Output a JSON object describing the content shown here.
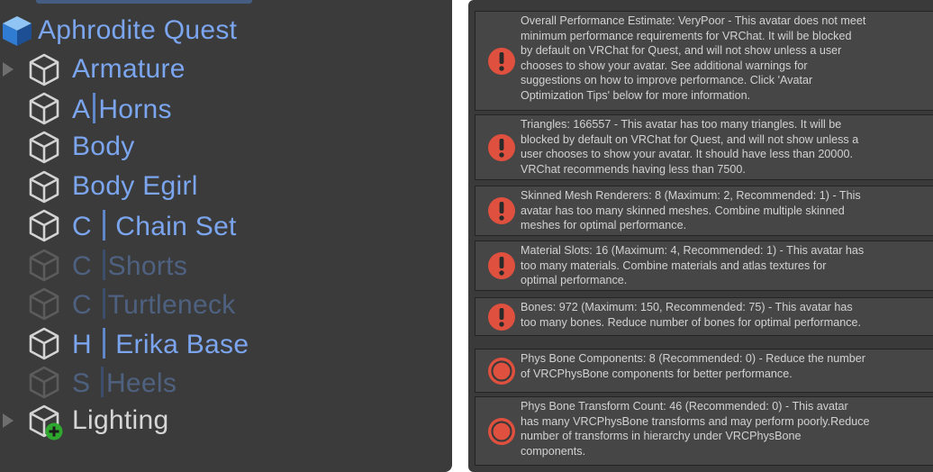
{
  "hierarchy": {
    "root_label": "Aphrodite Quest",
    "items": [
      {
        "name": "Armature"
      },
      {
        "prefix": "A",
        "sep": true,
        "name": "Horns"
      },
      {
        "name": "Body"
      },
      {
        "name": "Body Egirl"
      },
      {
        "prefix": "C ",
        "sep": true,
        "name": " Chain Set"
      },
      {
        "prefix": "C ",
        "sep": true,
        "name": "Shorts"
      },
      {
        "prefix": "C ",
        "sep": true,
        "name": "Turtleneck"
      },
      {
        "prefix": "H ",
        "sep": true,
        "name": " Erika Base"
      },
      {
        "prefix": "S ",
        "sep": true,
        "name": "Heels"
      },
      {
        "name": "Lighting"
      }
    ]
  },
  "warnings": [
    {
      "severity": "error",
      "text": "Overall Performance Estimate: VeryPoor - This avatar does not meet\nminimum performance requirements for VRChat. It will be blocked\nby default on VRChat for Quest, and will not show unless a user\nchooses to show your avatar. See additional warnings for\nsuggestions on how to improve performance. Click 'Avatar\nOptimization Tips' below for more information."
    },
    {
      "severity": "error",
      "text": "Triangles: 166557 - This avatar has too many triangles. It will be\nblocked by default on VRChat for Quest, and will not show unless a\nuser chooses to show your avatar. It should have less than 20000.\nVRChat recommends having less than 7500."
    },
    {
      "severity": "error",
      "text": "Skinned Mesh Renderers: 8 (Maximum: 2, Recommended: 1) - This\navatar has too many skinned meshes. Combine multiple skinned\nmeshes for optimal performance."
    },
    {
      "severity": "error",
      "text": "Material Slots: 16 (Maximum: 4, Recommended: 1) - This avatar has\ntoo many materials. Combine materials and atlas textures for\noptimal performance."
    },
    {
      "severity": "error",
      "text": "Bones: 972 (Maximum: 150, Recommended: 75) - This avatar has\ntoo many bones. Reduce number of bones for optimal performance."
    },
    {
      "severity": "very-poor",
      "text": "Phys Bone Components: 8 (Recommended: 0) - Reduce the number\nof VRCPhysBone components for better performance."
    },
    {
      "severity": "very-poor",
      "text": "Phys Bone Transform Count: 46 (Recommended: 0) - This avatar\nhas many VRCPhysBone transforms and may perform poorly.Reduce\nnumber of transforms in hierarchy under VRCPhysBone\ncomponents."
    }
  ],
  "icons": {
    "root": "prefab-cube-icon",
    "item": "gameobject-cube-icon",
    "added": "added-object-plus-icon",
    "error": "error-icon",
    "very_poor": "very-poor-icon"
  },
  "colors": {
    "prefab_text": "#7ba5ee",
    "inactive_prefab_text": "#4e6180",
    "plain_text": "#d6d6d6",
    "error_red": "#e0503e",
    "added_green": "#2fa82f"
  }
}
